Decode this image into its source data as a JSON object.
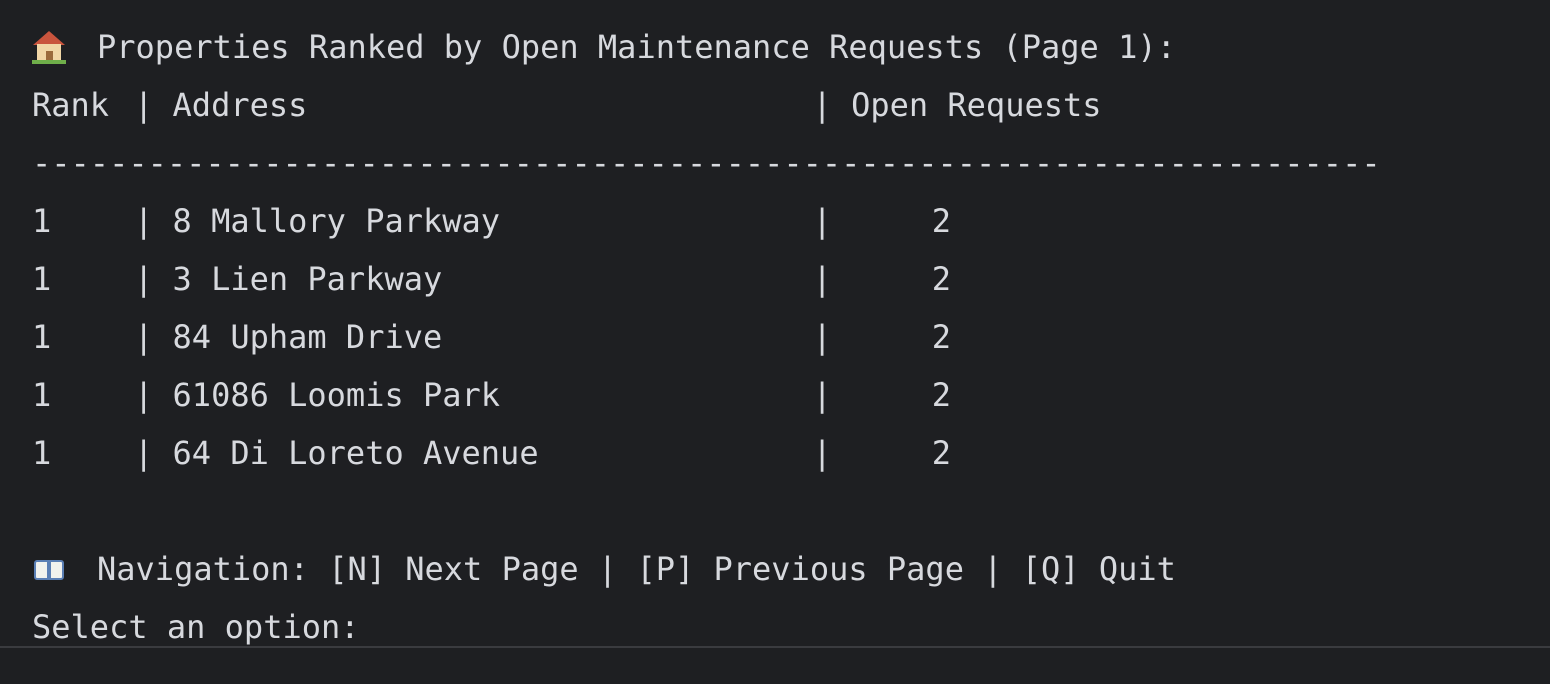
{
  "header": {
    "title": "Properties Ranked by Open Maintenance Requests (Page 1):",
    "icon": "house-icon"
  },
  "table": {
    "columns": {
      "rank": "Rank",
      "address": "Address",
      "open_requests": "Open Requests"
    },
    "separator": "|",
    "divider": "----------------------------------------------------------------------",
    "rows": [
      {
        "rank": "1",
        "address": "8 Mallory Parkway",
        "open_requests": "2"
      },
      {
        "rank": "1",
        "address": "3 Lien Parkway",
        "open_requests": "2"
      },
      {
        "rank": "1",
        "address": "84 Upham Drive",
        "open_requests": "2"
      },
      {
        "rank": "1",
        "address": "61086 Loomis Park",
        "open_requests": "2"
      },
      {
        "rank": "1",
        "address": "64 Di Loreto Avenue",
        "open_requests": "2"
      }
    ]
  },
  "navigation": {
    "icon": "book-icon",
    "text": "Navigation: [N] Next Page | [P] Previous Page | [Q] Quit"
  },
  "prompt": {
    "text": "Select an option:"
  },
  "colors": {
    "background": "#1e1f22",
    "foreground": "#d7d9de"
  }
}
